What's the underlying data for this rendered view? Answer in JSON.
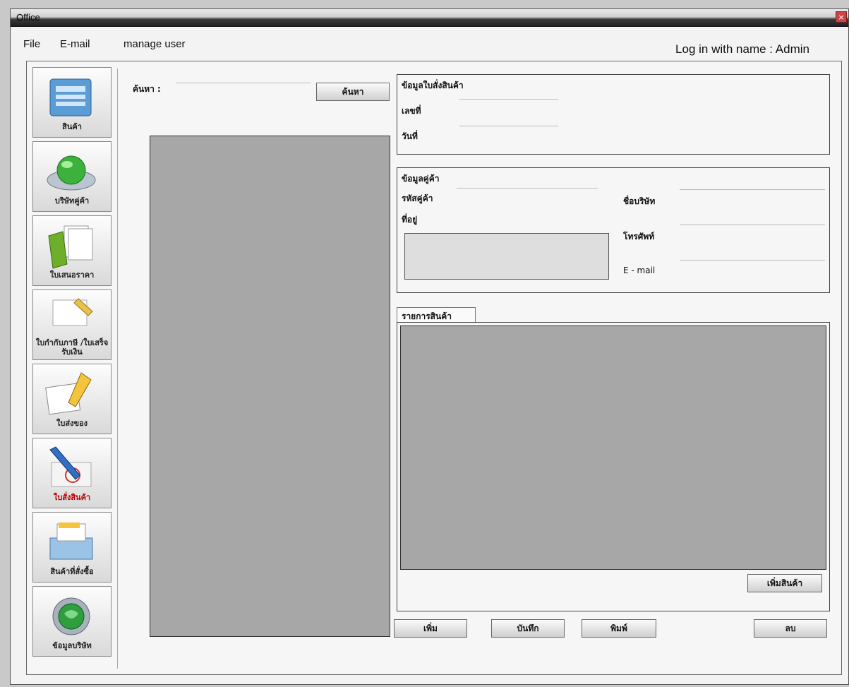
{
  "window": {
    "title": "Office",
    "close_glyph": "×"
  },
  "menu": {
    "file": "File",
    "email": "E-mail",
    "manage_user": "manage user"
  },
  "login_text": "Log in with name : Admin",
  "sidebar": [
    {
      "label": "สินค้า",
      "icon": "product-folder-icon"
    },
    {
      "label": "บริษัทคู่ค้า",
      "icon": "green-button-icon"
    },
    {
      "label": "ใบเสนอราคา",
      "icon": "folder-documents-icon"
    },
    {
      "label": "ใบกำกับภาษี /ใบเสร็จรับเงิน",
      "icon": "receipt-note-icon"
    },
    {
      "label": "ใบส่งของ",
      "icon": "delivery-note-icon"
    },
    {
      "label": "ใบสั่งสินค้า",
      "icon": "pen-order-icon",
      "highlight": true
    },
    {
      "label": "สินค้าที่สั่งซื้อ",
      "icon": "printer-order-icon"
    },
    {
      "label": "ข้อมูลบริษัท",
      "icon": "company-info-icon"
    }
  ],
  "search": {
    "label": "ค้นหา :",
    "button": "ค้นหา",
    "value": ""
  },
  "order_info": {
    "title": "ข้อมูลใบสั่งสินค้า",
    "number_label": "เลขที่",
    "date_label": "วันที่"
  },
  "customer_info": {
    "title": "ข้อมูลคู่ค้า",
    "code_label": "รหัสคู่ค้า",
    "address_label": "ที่อยู่",
    "company_label": "ชื่อบริษัท",
    "phone_label": "โทรศัพท์",
    "email_label": "E - mail"
  },
  "items": {
    "tab_label": "รายการสินค้า",
    "add_button": "เพิ่มสินค้า"
  },
  "actions": {
    "add": "เพิ่ม",
    "save": "บันทึก",
    "print": "พิมพ์",
    "delete": "ลบ"
  },
  "colors": {
    "grid": "#a7a7a7",
    "window_bg": "#f3f3f3",
    "highlight_label": "#bb0000"
  }
}
